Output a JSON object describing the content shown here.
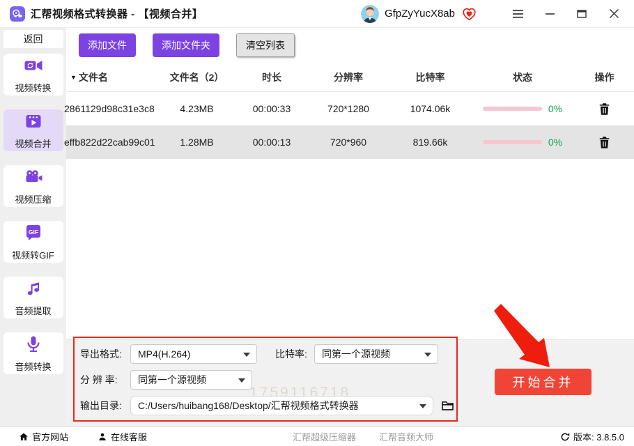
{
  "titlebar": {
    "title": "汇帮视频格式转换器 - 【视频合并】",
    "username": "GfpZyYucX8ab"
  },
  "sidebar": {
    "back_label": "返回",
    "items": [
      {
        "label": "视频转换",
        "icon": "video-convert-icon",
        "active": false
      },
      {
        "label": "视频合并",
        "icon": "video-merge-icon",
        "active": true
      },
      {
        "label": "视频压缩",
        "icon": "video-compress-icon",
        "active": false
      },
      {
        "label": "视频转GIF",
        "icon": "video-to-gif-icon",
        "active": false
      },
      {
        "label": "音频提取",
        "icon": "audio-extract-icon",
        "active": false
      },
      {
        "label": "音频转换",
        "icon": "audio-convert-icon",
        "active": false
      }
    ],
    "gif_icon_text": "GIF"
  },
  "toolbar": {
    "add_file": "添加文件",
    "add_folder": "添加文件夹",
    "clear_list": "清空列表"
  },
  "table": {
    "headers": {
      "filename": "文件名",
      "filename2": "文件名（2）",
      "duration": "时长",
      "resolution": "分辨率",
      "bitrate": "比特率",
      "status": "状态",
      "action": "操作"
    },
    "rows": [
      {
        "filename": "2861129d98c31e3c8",
        "size": "4.23MB",
        "duration": "00:00:33",
        "resolution": "720*1280",
        "bitrate": "1074.06k",
        "progress": "0%"
      },
      {
        "filename": "effb822d22cab99c01",
        "size": "1.28MB",
        "duration": "00:00:13",
        "resolution": "720*960",
        "bitrate": "819.66k",
        "progress": "0%"
      }
    ]
  },
  "settings": {
    "export_format_label": "导出格式:",
    "export_format_value": "MP4(H.264)",
    "bitrate_label": "比特率:",
    "bitrate_value": "同第一个源视频",
    "resolution_label": "分 辨 率:",
    "resolution_value": "同第一个源视频",
    "output_dir_label": "输出目录:",
    "output_dir_value": "C:/Users/huibang168/Desktop/汇帮视频格式转换器"
  },
  "actions": {
    "start_merge": "开始合并"
  },
  "watermark": "1759116718",
  "statusbar": {
    "official_site": "官方网站",
    "online_service": "在线客服",
    "super_compressor": "汇帮超级压缩器",
    "audio_master": "汇帮音频大师",
    "version": "版本: 3.8.5.0"
  },
  "colors": {
    "accent_purple": "#7c42e2",
    "active_nav_bg": "#e5d9f8",
    "start_button_red": "#f04536",
    "arrow_red": "#ee1d0e",
    "progress_pink": "#f6c6d3",
    "progress_green": "#16a34a"
  }
}
